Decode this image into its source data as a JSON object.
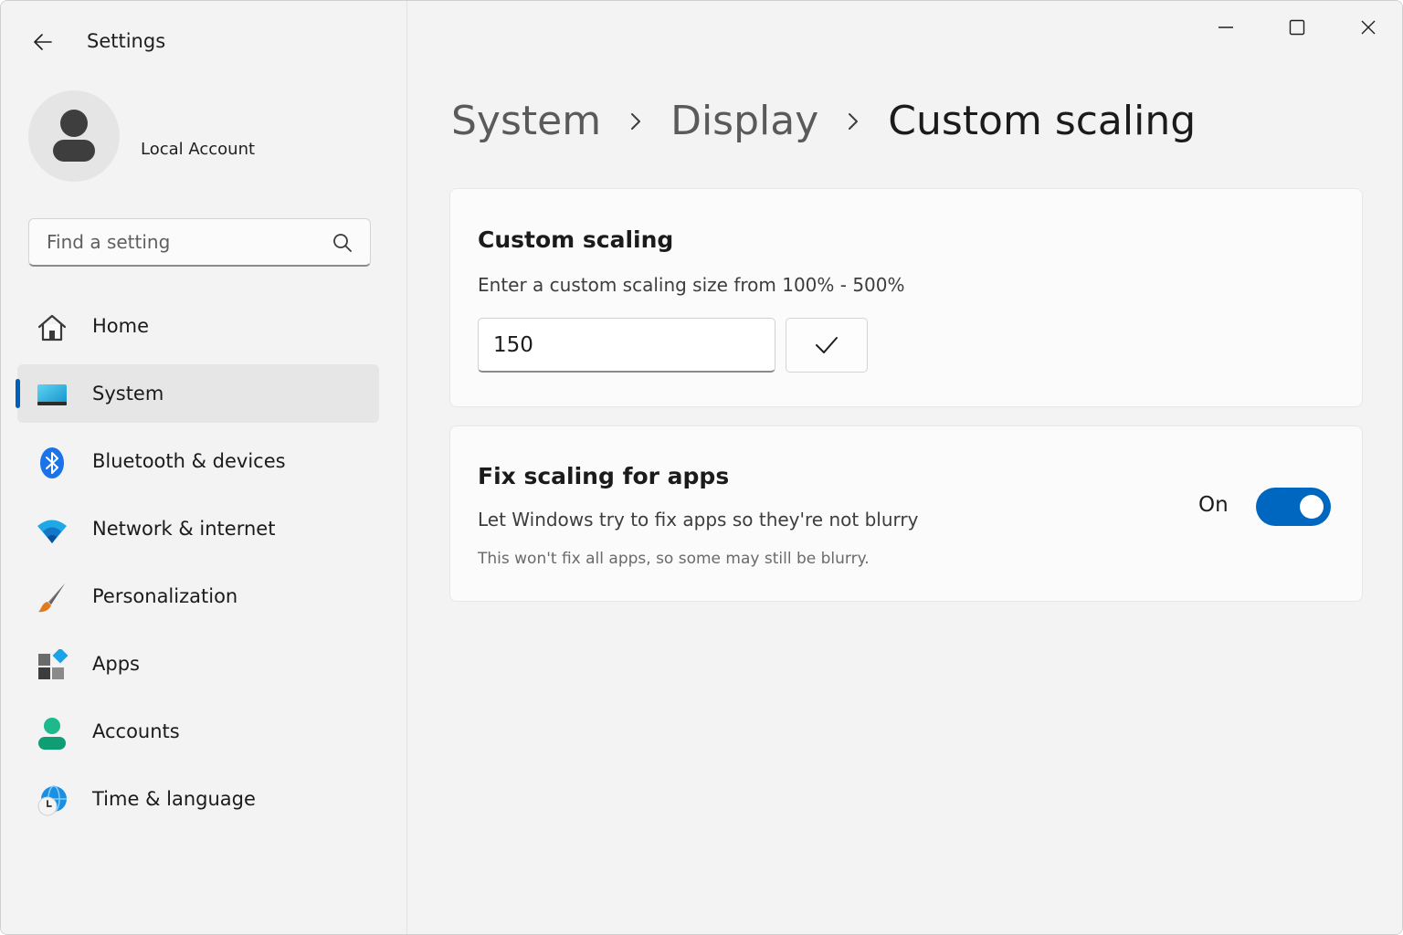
{
  "app": {
    "title": "Settings"
  },
  "account": {
    "name": "Local Account"
  },
  "search": {
    "placeholder": "Find a setting",
    "value": ""
  },
  "nav": {
    "items": [
      {
        "label": "Home",
        "icon": "home-icon"
      },
      {
        "label": "System",
        "icon": "system-display-icon",
        "selected": true
      },
      {
        "label": "Bluetooth & devices",
        "icon": "bluetooth-icon"
      },
      {
        "label": "Network & internet",
        "icon": "wifi-icon"
      },
      {
        "label": "Personalization",
        "icon": "paintbrush-icon"
      },
      {
        "label": "Apps",
        "icon": "apps-icon"
      },
      {
        "label": "Accounts",
        "icon": "person-icon"
      },
      {
        "label": "Time & language",
        "icon": "globe-clock-icon"
      }
    ]
  },
  "breadcrumb": {
    "items": [
      "System",
      "Display",
      "Custom scaling"
    ]
  },
  "custom_scaling": {
    "title": "Custom scaling",
    "description": "Enter a custom scaling size from 100% - 500%",
    "value": "150"
  },
  "fix_scaling": {
    "title": "Fix scaling for apps",
    "description": "Let Windows try to fix apps so they're not blurry",
    "note": "This won't fix all apps, so some may still be blurry.",
    "toggle_label": "On",
    "enabled": true
  },
  "colors": {
    "accent": "#005fb8",
    "toggle_on": "#0067c0",
    "background": "#f3f3f3",
    "card": "#fbfbfb"
  }
}
